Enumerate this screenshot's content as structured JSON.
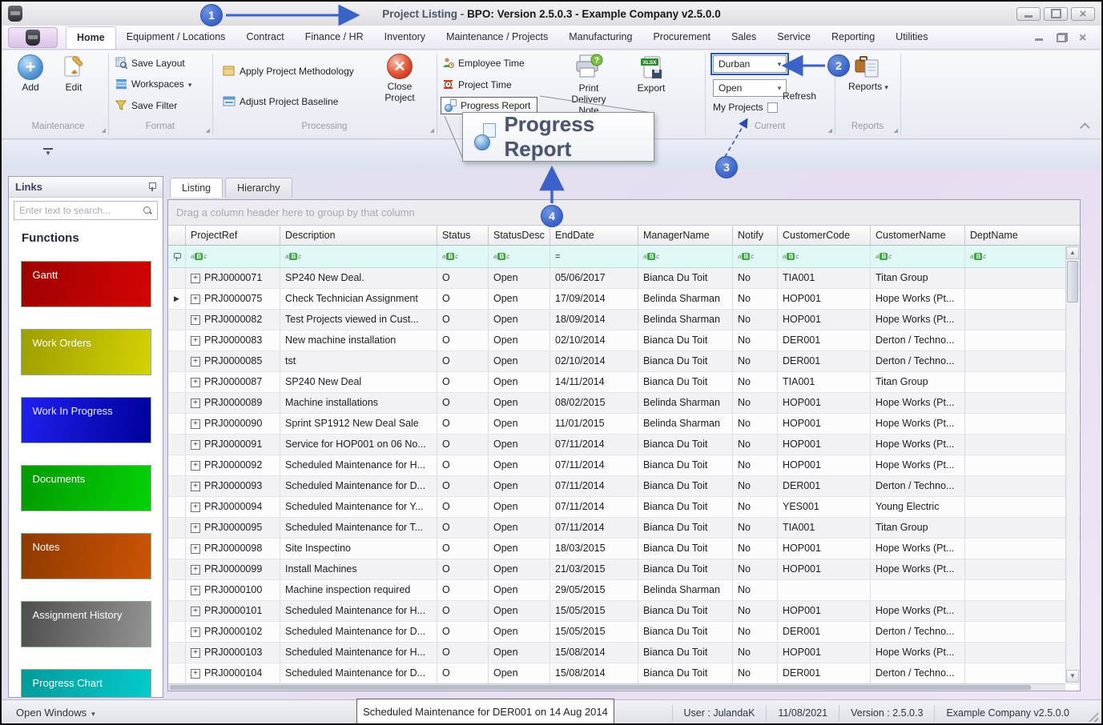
{
  "window": {
    "title_prefix": "Project Listing -",
    "title_main": "BPO: Version 2.5.0.3 - Example Company v2.5.0.0"
  },
  "menu_tabs": [
    {
      "label": "Home",
      "active": true
    },
    {
      "label": "Equipment / Locations"
    },
    {
      "label": "Contract"
    },
    {
      "label": "Finance / HR"
    },
    {
      "label": "Inventory"
    },
    {
      "label": "Maintenance / Projects"
    },
    {
      "label": "Manufacturing"
    },
    {
      "label": "Procurement"
    },
    {
      "label": "Sales"
    },
    {
      "label": "Service"
    },
    {
      "label": "Reporting"
    },
    {
      "label": "Utilities"
    }
  ],
  "ribbon": {
    "maintenance": {
      "label": "Maintenance",
      "add": "Add",
      "edit": "Edit"
    },
    "format": {
      "label": "Format",
      "save_layout": "Save Layout",
      "workspaces": "Workspaces",
      "save_filter": "Save Filter"
    },
    "processing": {
      "label": "Processing",
      "apply": "Apply Project Methodology",
      "adjust": "Adjust Project Baseline",
      "close_project": "Close Project"
    },
    "time": {
      "employee_time": "Employee Time",
      "project_time": "Project Time",
      "progress_report": "Progress Report",
      "print_delivery": "Print Delivery Note",
      "export": "Export"
    },
    "current": {
      "label": "Current",
      "site_value": "Durban",
      "status_value": "Open",
      "my_projects": "My Projects",
      "refresh": "Refresh"
    },
    "reports": {
      "label": "Reports",
      "button": "Reports"
    }
  },
  "icons": {
    "text_filter_icon": "aBc",
    "equals_filter_icon": "=",
    "dropdown_arrow": "▾"
  },
  "popup": {
    "label": "Progress Report"
  },
  "callouts": {
    "one": "1",
    "two": "2",
    "three": "3",
    "four": "4"
  },
  "sidebar": {
    "title": "Links",
    "search_placeholder": "Enter text to search...",
    "section": "Functions",
    "buttons": [
      {
        "label": "Gantt",
        "c1": "#9e0202",
        "c2": "#d40404",
        "color": "#ffffff"
      },
      {
        "label": "Work Orders",
        "c1": "#9e9e02",
        "c2": "#d2d204",
        "color": "#ffffff"
      },
      {
        "label": "Work In Progress",
        "c1": "#2020f0",
        "c2": "#00009a",
        "color": "#e8f0ff"
      },
      {
        "label": "Documents",
        "c1": "#029a02",
        "c2": "#04d204",
        "color": "#ffffff"
      },
      {
        "label": "Notes",
        "c1": "#8e3a02",
        "c2": "#cc5404",
        "color": "#ffffff"
      },
      {
        "label": "Assignment History",
        "c1": "#4e4e4e",
        "c2": "#949494",
        "color": "#ffffff"
      },
      {
        "label": "Progress Chart",
        "c1": "#029a9a",
        "c2": "#04cccc",
        "color": "#ffffff"
      }
    ]
  },
  "grid": {
    "tabs": [
      {
        "label": "Listing",
        "active": true
      },
      {
        "label": "Hierarchy"
      }
    ],
    "group_hint": "Drag a column header here to group by that column",
    "columns": [
      "ProjectRef",
      "Description",
      "Status",
      "StatusDesc",
      "EndDate",
      "ManagerName",
      "Notify",
      "CustomerCode",
      "CustomerName",
      "DeptName"
    ],
    "rows": [
      {
        "ref": "PRJ0000071",
        "desc": "SP240 New Deal.",
        "status": "O",
        "sdesc": "Open",
        "edate": "05/06/2017",
        "mgr": "Bianca Du Toit",
        "notify": "No",
        "ccode": "TIA001",
        "cname": "Titan Group",
        "dept": ""
      },
      {
        "ref": "PRJ0000075",
        "desc": "Check Technician Assignment",
        "status": "O",
        "sdesc": "Open",
        "edate": "17/09/2014",
        "mgr": "Belinda Sharman",
        "notify": "No",
        "ccode": "HOP001",
        "cname": "Hope Works (Pt...",
        "dept": "",
        "selected": true
      },
      {
        "ref": "PRJ0000082",
        "desc": "Test Projects viewed in Cust...",
        "status": "O",
        "sdesc": "Open",
        "edate": "18/09/2014",
        "mgr": "Belinda Sharman",
        "notify": "No",
        "ccode": "HOP001",
        "cname": "Hope Works (Pt...",
        "dept": ""
      },
      {
        "ref": "PRJ0000083",
        "desc": "New machine installation",
        "status": "O",
        "sdesc": "Open",
        "edate": "02/10/2014",
        "mgr": "Bianca Du Toit",
        "notify": "No",
        "ccode": "DER001",
        "cname": "Derton / Techno...",
        "dept": ""
      },
      {
        "ref": "PRJ0000085",
        "desc": "tst",
        "status": "O",
        "sdesc": "Open",
        "edate": "02/10/2014",
        "mgr": "Bianca Du Toit",
        "notify": "No",
        "ccode": "DER001",
        "cname": "Derton / Techno...",
        "dept": ""
      },
      {
        "ref": "PRJ0000087",
        "desc": "SP240 New Deal",
        "status": "O",
        "sdesc": "Open",
        "edate": "14/11/2014",
        "mgr": "Bianca Du Toit",
        "notify": "No",
        "ccode": "TIA001",
        "cname": "Titan Group",
        "dept": ""
      },
      {
        "ref": "PRJ0000089",
        "desc": "Machine installations",
        "status": "O",
        "sdesc": "Open",
        "edate": "08/02/2015",
        "mgr": "Belinda Sharman",
        "notify": "No",
        "ccode": "HOP001",
        "cname": "Hope Works (Pt...",
        "dept": ""
      },
      {
        "ref": "PRJ0000090",
        "desc": "Sprint SP1912 New Deal Sale",
        "status": "O",
        "sdesc": "Open",
        "edate": "11/01/2015",
        "mgr": "Belinda Sharman",
        "notify": "No",
        "ccode": "HOP001",
        "cname": "Hope Works (Pt...",
        "dept": ""
      },
      {
        "ref": "PRJ0000091",
        "desc": "Service for HOP001 on 06 No...",
        "status": "O",
        "sdesc": "Open",
        "edate": "07/11/2014",
        "mgr": "Bianca Du Toit",
        "notify": "No",
        "ccode": "HOP001",
        "cname": "Hope Works (Pt...",
        "dept": ""
      },
      {
        "ref": "PRJ0000092",
        "desc": "Scheduled Maintenance for H...",
        "status": "O",
        "sdesc": "Open",
        "edate": "07/11/2014",
        "mgr": "Bianca Du Toit",
        "notify": "No",
        "ccode": "HOP001",
        "cname": "Hope Works (Pt...",
        "dept": ""
      },
      {
        "ref": "PRJ0000093",
        "desc": "Scheduled Maintenance for D...",
        "status": "O",
        "sdesc": "Open",
        "edate": "07/11/2014",
        "mgr": "Bianca Du Toit",
        "notify": "No",
        "ccode": "DER001",
        "cname": "Derton / Techno...",
        "dept": ""
      },
      {
        "ref": "PRJ0000094",
        "desc": "Scheduled Maintenance for Y...",
        "status": "O",
        "sdesc": "Open",
        "edate": "07/11/2014",
        "mgr": "Bianca Du Toit",
        "notify": "No",
        "ccode": "YES001",
        "cname": "Young Electric",
        "dept": ""
      },
      {
        "ref": "PRJ0000095",
        "desc": "Scheduled Maintenance for T...",
        "status": "O",
        "sdesc": "Open",
        "edate": "07/11/2014",
        "mgr": "Bianca Du Toit",
        "notify": "No",
        "ccode": "TIA001",
        "cname": "Titan Group",
        "dept": ""
      },
      {
        "ref": "PRJ0000098",
        "desc": "Site Inspectino",
        "status": "O",
        "sdesc": "Open",
        "edate": "18/03/2015",
        "mgr": "Bianca Du Toit",
        "notify": "No",
        "ccode": "HOP001",
        "cname": "Hope Works (Pt...",
        "dept": ""
      },
      {
        "ref": "PRJ0000099",
        "desc": "Install Machines",
        "status": "O",
        "sdesc": "Open",
        "edate": "21/03/2015",
        "mgr": "Bianca Du Toit",
        "notify": "No",
        "ccode": "HOP001",
        "cname": "Hope Works (Pt...",
        "dept": ""
      },
      {
        "ref": "PRJ0000100",
        "desc": "Machine inspection required",
        "status": "O",
        "sdesc": "Open",
        "edate": "29/05/2015",
        "mgr": "Belinda Sharman",
        "notify": "No",
        "ccode": "",
        "cname": "",
        "dept": ""
      },
      {
        "ref": "PRJ0000101",
        "desc": "Scheduled Maintenance for H...",
        "status": "O",
        "sdesc": "Open",
        "edate": "15/05/2015",
        "mgr": "Bianca Du Toit",
        "notify": "No",
        "ccode": "HOP001",
        "cname": "Hope Works (Pt...",
        "dept": ""
      },
      {
        "ref": "PRJ0000102",
        "desc": "Scheduled Maintenance for D...",
        "status": "O",
        "sdesc": "Open",
        "edate": "15/05/2015",
        "mgr": "Bianca Du Toit",
        "notify": "No",
        "ccode": "DER001",
        "cname": "Derton / Techno...",
        "dept": ""
      },
      {
        "ref": "PRJ0000103",
        "desc": "Scheduled Maintenance for H...",
        "status": "O",
        "sdesc": "Open",
        "edate": "15/08/2014",
        "mgr": "Bianca Du Toit",
        "notify": "No",
        "ccode": "HOP001",
        "cname": "Hope Works (Pt...",
        "dept": ""
      },
      {
        "ref": "PRJ0000104",
        "desc": "Scheduled Maintenance for D...",
        "status": "O",
        "sdesc": "Open",
        "edate": "15/08/2014",
        "mgr": "Bianca Du Toit",
        "notify": "No",
        "ccode": "DER001",
        "cname": "Derton / Techno...",
        "dept": ""
      }
    ]
  },
  "tooltip": {
    "text": "Scheduled Maintenance for DER001 on 14 Aug 2014"
  },
  "statusbar": {
    "open_windows": "Open Windows",
    "user": "User : JulandaK",
    "date": "11/08/2021",
    "version": "Version : 2.5.0.3",
    "company": "Example Company v2.5.0.0"
  },
  "colors": {
    "accent_blue": "#3a62c8",
    "filter_row": "#dff7f5",
    "highlight_border": "#2458c8"
  }
}
